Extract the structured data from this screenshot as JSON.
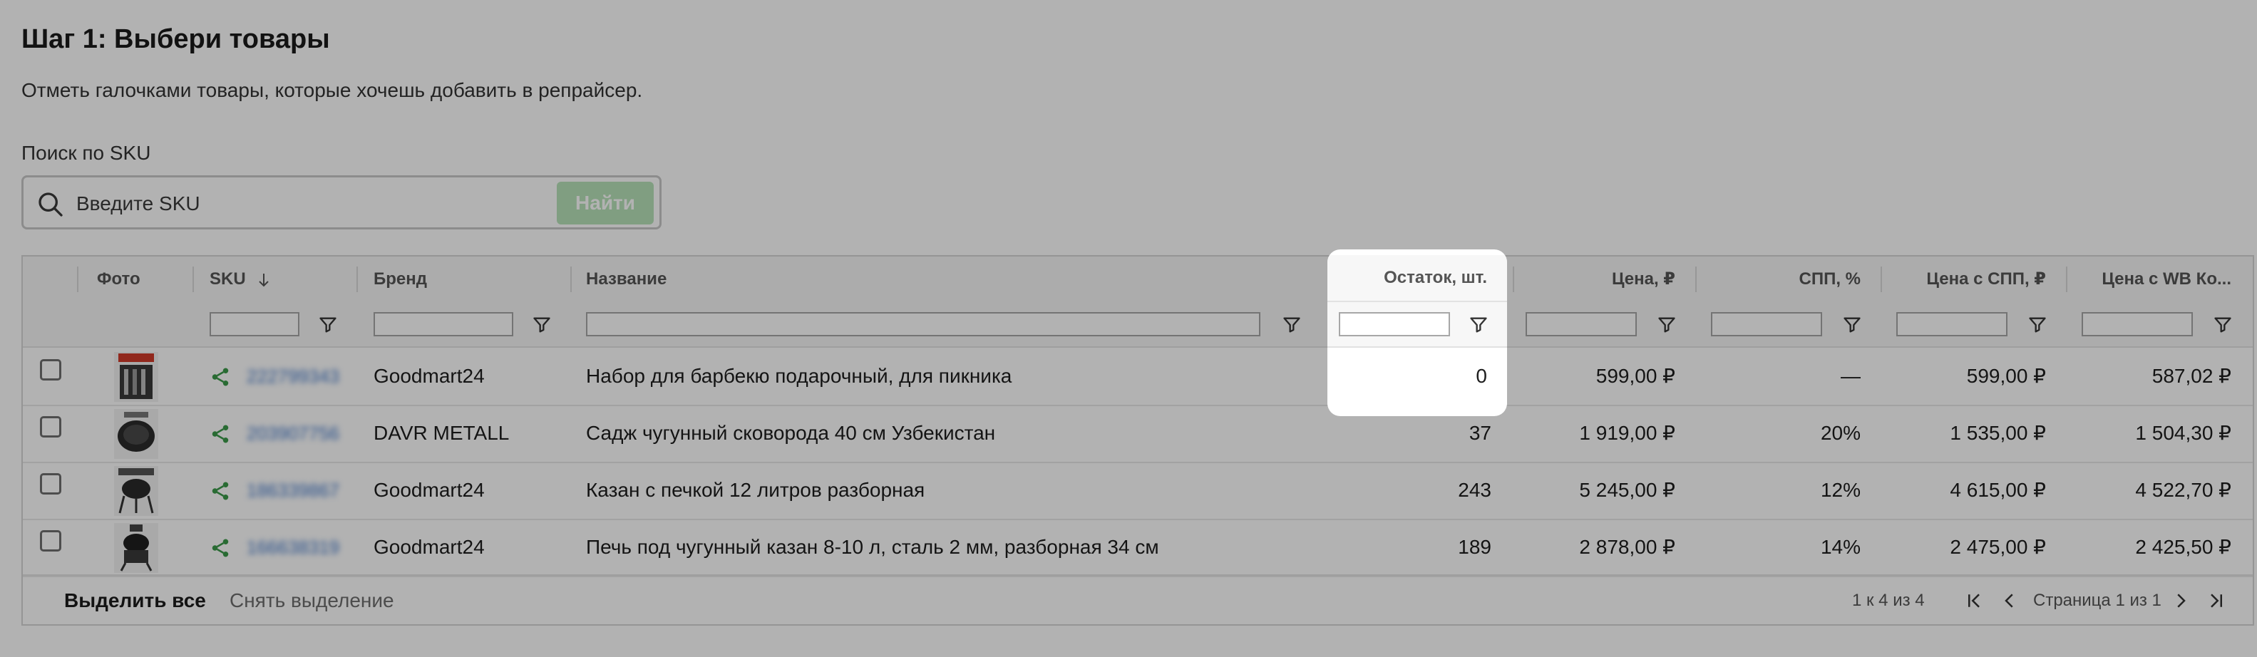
{
  "page": {
    "title": "Шаг 1: Выбери товары",
    "subtitle": "Отметь галочками товары, которые хочешь добавить в репрайсер."
  },
  "search": {
    "label": "Поиск по SKU",
    "placeholder": "Введите SKU",
    "value": "",
    "button_label": "Найти"
  },
  "table": {
    "columns": {
      "photo": "Фото",
      "sku": "SKU",
      "brand": "Бренд",
      "name": "Название",
      "stock": "Остаток, шт.",
      "price": "Цена, ₽",
      "spp": "СПП, %",
      "price_spp": "Цена с СПП, ₽",
      "price_wb": "Цена с WB Ко..."
    },
    "sort": {
      "column": "SKU",
      "direction": "descending"
    },
    "rows": [
      {
        "sku": "222799343",
        "brand": "Goodmart24",
        "name": "Набор для барбекю подарочный, для пикника",
        "stock": "0",
        "price": "599,00 ₽",
        "spp": "—",
        "price_spp": "599,00 ₽",
        "price_wb": "587,02 ₽",
        "checked": false
      },
      {
        "sku": "203907756",
        "brand": "DAVR METALL",
        "name": "Садж чугунный сковорода 40 см Узбекистан",
        "stock": "37",
        "price": "1 919,00 ₽",
        "spp": "20%",
        "price_spp": "1 535,00 ₽",
        "price_wb": "1 504,30 ₽",
        "checked": false
      },
      {
        "sku": "186339867",
        "brand": "Goodmart24",
        "name": "Казан с печкой 12 литров разборная",
        "stock": "243",
        "price": "5 245,00 ₽",
        "spp": "12%",
        "price_spp": "4 615,00 ₽",
        "price_wb": "4 522,70 ₽",
        "checked": false
      },
      {
        "sku": "166638319",
        "brand": "Goodmart24",
        "name": "Печь под чугунный казан 8-10 л, сталь 2 мм, разборная 34 см",
        "stock": "189",
        "price": "2 878,00 ₽",
        "spp": "14%",
        "price_spp": "2 475,00 ₽",
        "price_wb": "2 425,50 ₽",
        "checked": false
      }
    ]
  },
  "footer": {
    "select_all": "Выделить все",
    "clear_selection": "Снять выделение",
    "range": "1 к 4 из 4",
    "page": "Страница 1 из 1"
  },
  "colors": {
    "accent_button": "#b8e3b9",
    "share_icon": "#3c9a4a",
    "sku_link": "#3f76c9",
    "overlay": "rgba(0,0,0,0.30)"
  },
  "icons": {
    "search": "search-icon",
    "sort": "arrow-down-icon",
    "filter": "filter-icon",
    "share": "share-icon",
    "first": "first-page-icon",
    "prev": "prev-page-icon",
    "next": "next-page-icon",
    "last": "last-page-icon"
  },
  "highlight": {
    "column": "stock"
  }
}
